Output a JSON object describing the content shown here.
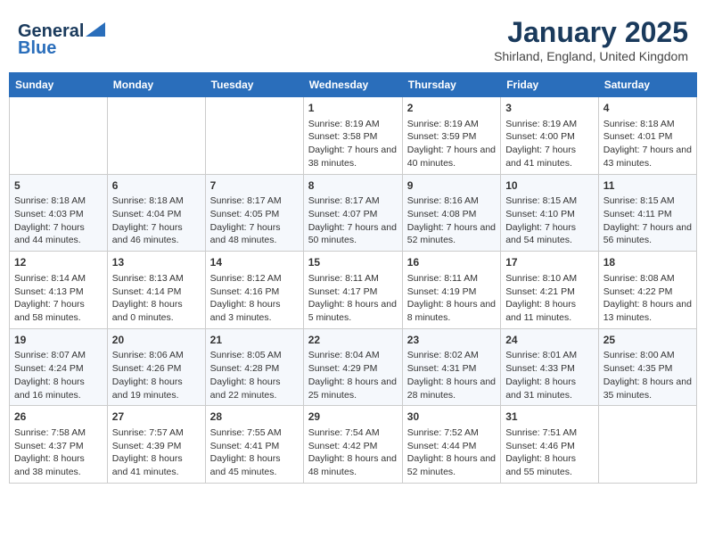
{
  "header": {
    "logo_general": "General",
    "logo_blue": "Blue",
    "month": "January 2025",
    "location": "Shirland, England, United Kingdom"
  },
  "days_of_week": [
    "Sunday",
    "Monday",
    "Tuesday",
    "Wednesday",
    "Thursday",
    "Friday",
    "Saturday"
  ],
  "weeks": [
    [
      {
        "day": "",
        "empty": true
      },
      {
        "day": "",
        "empty": true
      },
      {
        "day": "",
        "empty": true
      },
      {
        "day": "1",
        "sunrise": "8:19 AM",
        "sunset": "3:58 PM",
        "daylight": "7 hours and 38 minutes."
      },
      {
        "day": "2",
        "sunrise": "8:19 AM",
        "sunset": "3:59 PM",
        "daylight": "7 hours and 40 minutes."
      },
      {
        "day": "3",
        "sunrise": "8:19 AM",
        "sunset": "4:00 PM",
        "daylight": "7 hours and 41 minutes."
      },
      {
        "day": "4",
        "sunrise": "8:18 AM",
        "sunset": "4:01 PM",
        "daylight": "7 hours and 43 minutes."
      }
    ],
    [
      {
        "day": "5",
        "sunrise": "8:18 AM",
        "sunset": "4:03 PM",
        "daylight": "7 hours and 44 minutes."
      },
      {
        "day": "6",
        "sunrise": "8:18 AM",
        "sunset": "4:04 PM",
        "daylight": "7 hours and 46 minutes."
      },
      {
        "day": "7",
        "sunrise": "8:17 AM",
        "sunset": "4:05 PM",
        "daylight": "7 hours and 48 minutes."
      },
      {
        "day": "8",
        "sunrise": "8:17 AM",
        "sunset": "4:07 PM",
        "daylight": "7 hours and 50 minutes."
      },
      {
        "day": "9",
        "sunrise": "8:16 AM",
        "sunset": "4:08 PM",
        "daylight": "7 hours and 52 minutes."
      },
      {
        "day": "10",
        "sunrise": "8:15 AM",
        "sunset": "4:10 PM",
        "daylight": "7 hours and 54 minutes."
      },
      {
        "day": "11",
        "sunrise": "8:15 AM",
        "sunset": "4:11 PM",
        "daylight": "7 hours and 56 minutes."
      }
    ],
    [
      {
        "day": "12",
        "sunrise": "8:14 AM",
        "sunset": "4:13 PM",
        "daylight": "7 hours and 58 minutes."
      },
      {
        "day": "13",
        "sunrise": "8:13 AM",
        "sunset": "4:14 PM",
        "daylight": "8 hours and 0 minutes."
      },
      {
        "day": "14",
        "sunrise": "8:12 AM",
        "sunset": "4:16 PM",
        "daylight": "8 hours and 3 minutes."
      },
      {
        "day": "15",
        "sunrise": "8:11 AM",
        "sunset": "4:17 PM",
        "daylight": "8 hours and 5 minutes."
      },
      {
        "day": "16",
        "sunrise": "8:11 AM",
        "sunset": "4:19 PM",
        "daylight": "8 hours and 8 minutes."
      },
      {
        "day": "17",
        "sunrise": "8:10 AM",
        "sunset": "4:21 PM",
        "daylight": "8 hours and 11 minutes."
      },
      {
        "day": "18",
        "sunrise": "8:08 AM",
        "sunset": "4:22 PM",
        "daylight": "8 hours and 13 minutes."
      }
    ],
    [
      {
        "day": "19",
        "sunrise": "8:07 AM",
        "sunset": "4:24 PM",
        "daylight": "8 hours and 16 minutes."
      },
      {
        "day": "20",
        "sunrise": "8:06 AM",
        "sunset": "4:26 PM",
        "daylight": "8 hours and 19 minutes."
      },
      {
        "day": "21",
        "sunrise": "8:05 AM",
        "sunset": "4:28 PM",
        "daylight": "8 hours and 22 minutes."
      },
      {
        "day": "22",
        "sunrise": "8:04 AM",
        "sunset": "4:29 PM",
        "daylight": "8 hours and 25 minutes."
      },
      {
        "day": "23",
        "sunrise": "8:02 AM",
        "sunset": "4:31 PM",
        "daylight": "8 hours and 28 minutes."
      },
      {
        "day": "24",
        "sunrise": "8:01 AM",
        "sunset": "4:33 PM",
        "daylight": "8 hours and 31 minutes."
      },
      {
        "day": "25",
        "sunrise": "8:00 AM",
        "sunset": "4:35 PM",
        "daylight": "8 hours and 35 minutes."
      }
    ],
    [
      {
        "day": "26",
        "sunrise": "7:58 AM",
        "sunset": "4:37 PM",
        "daylight": "8 hours and 38 minutes."
      },
      {
        "day": "27",
        "sunrise": "7:57 AM",
        "sunset": "4:39 PM",
        "daylight": "8 hours and 41 minutes."
      },
      {
        "day": "28",
        "sunrise": "7:55 AM",
        "sunset": "4:41 PM",
        "daylight": "8 hours and 45 minutes."
      },
      {
        "day": "29",
        "sunrise": "7:54 AM",
        "sunset": "4:42 PM",
        "daylight": "8 hours and 48 minutes."
      },
      {
        "day": "30",
        "sunrise": "7:52 AM",
        "sunset": "4:44 PM",
        "daylight": "8 hours and 52 minutes."
      },
      {
        "day": "31",
        "sunrise": "7:51 AM",
        "sunset": "4:46 PM",
        "daylight": "8 hours and 55 minutes."
      },
      {
        "day": "",
        "empty": true
      }
    ]
  ],
  "labels": {
    "sunrise": "Sunrise:",
    "sunset": "Sunset:",
    "daylight": "Daylight hours"
  }
}
